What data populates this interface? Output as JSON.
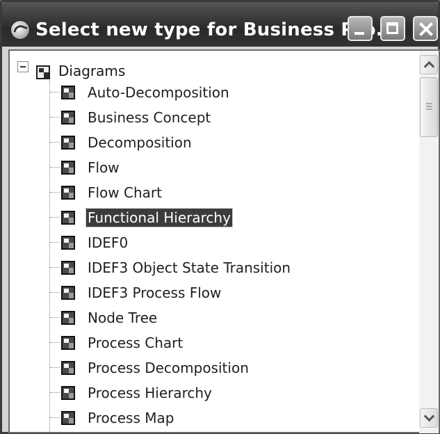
{
  "window": {
    "title": "Select new type for Business Pro...",
    "app_icon": "app-globe-icon",
    "buttons": {
      "minimize": "minimize-icon",
      "maximize": "maximize-icon",
      "close": "close-icon"
    }
  },
  "tree": {
    "root": {
      "label": "Diagrams",
      "expanded": true,
      "icon": "diagram-folder-icon"
    },
    "items": [
      {
        "label": "Auto-Decomposition",
        "selected": false
      },
      {
        "label": "Business Concept",
        "selected": false
      },
      {
        "label": "Decomposition",
        "selected": false
      },
      {
        "label": "Flow",
        "selected": false
      },
      {
        "label": "Flow Chart",
        "selected": false
      },
      {
        "label": "Functional Hierarchy",
        "selected": true
      },
      {
        "label": "IDEF0",
        "selected": false
      },
      {
        "label": "IDEF3 Object State Transition",
        "selected": false
      },
      {
        "label": "IDEF3 Process Flow",
        "selected": false
      },
      {
        "label": "Node Tree",
        "selected": false
      },
      {
        "label": "Process Chart",
        "selected": false
      },
      {
        "label": "Process Decomposition",
        "selected": false
      },
      {
        "label": "Process Hierarchy",
        "selected": false
      },
      {
        "label": "Process Map",
        "selected": false
      }
    ]
  },
  "colors": {
    "titlebar": "#2f2f2f",
    "selection": "#3c3c3c",
    "tree_background": "#ffffff"
  }
}
